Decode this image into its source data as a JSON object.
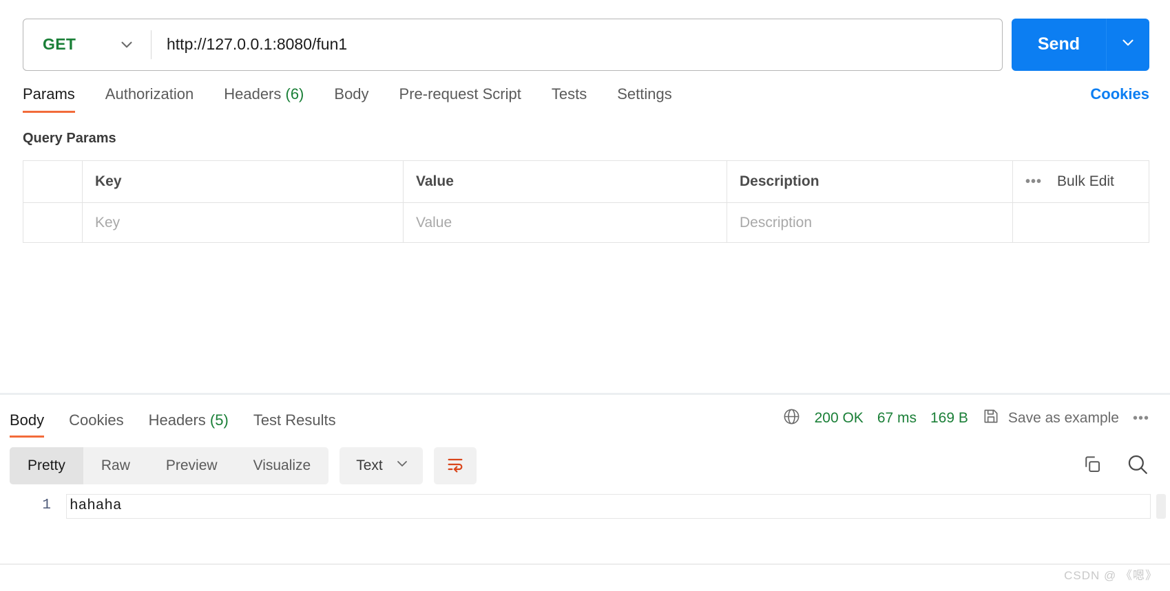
{
  "request": {
    "method": "GET",
    "url": "http://127.0.0.1:8080/fun1",
    "send_label": "Send",
    "method_caret_icon": "chevron-down-icon",
    "send_caret_icon": "chevron-down-icon"
  },
  "request_tabs": [
    {
      "label": "Params",
      "count": "",
      "active": true
    },
    {
      "label": "Authorization",
      "count": "",
      "active": false
    },
    {
      "label": "Headers",
      "count": "(6)",
      "active": false
    },
    {
      "label": "Body",
      "count": "",
      "active": false
    },
    {
      "label": "Pre-request Script",
      "count": "",
      "active": false
    },
    {
      "label": "Tests",
      "count": "",
      "active": false
    },
    {
      "label": "Settings",
      "count": "",
      "active": false
    }
  ],
  "cookies_link": "Cookies",
  "query_params": {
    "title": "Query Params",
    "headers": {
      "key": "Key",
      "value": "Value",
      "description": "Description"
    },
    "bulk_edit": "Bulk Edit",
    "more_icon": "ellipsis-icon",
    "placeholder_row": {
      "key": "Key",
      "value": "Value",
      "description": "Description"
    }
  },
  "response_tabs": [
    {
      "label": "Body",
      "count": "",
      "active": true
    },
    {
      "label": "Cookies",
      "count": "",
      "active": false
    },
    {
      "label": "Headers",
      "count": "(5)",
      "active": false
    },
    {
      "label": "Test Results",
      "count": "",
      "active": false
    }
  ],
  "response_meta": {
    "network_icon": "globe-icon",
    "status": "200 OK",
    "time": "67 ms",
    "size": "169 B",
    "save_icon": "floppy-disk-icon",
    "save_label": "Save as example",
    "more_icon": "ellipsis-icon"
  },
  "body_toolbar": {
    "views": [
      {
        "label": "Pretty",
        "active": true
      },
      {
        "label": "Raw",
        "active": false
      },
      {
        "label": "Preview",
        "active": false
      },
      {
        "label": "Visualize",
        "active": false
      }
    ],
    "format": "Text",
    "format_caret_icon": "chevron-down-icon",
    "wrap_icon": "wrap-text-icon",
    "copy_icon": "copy-icon",
    "search_icon": "search-icon"
  },
  "response_body": {
    "lines": [
      {
        "number": "1",
        "text": "hahaha"
      }
    ]
  },
  "watermark": "CSDN @ 《嗯》",
  "colors": {
    "accent_blue": "#0c7ef2",
    "tab_underline": "#f26b3a",
    "status_green": "#1a7f37",
    "wrap_orange": "#d9451a"
  }
}
